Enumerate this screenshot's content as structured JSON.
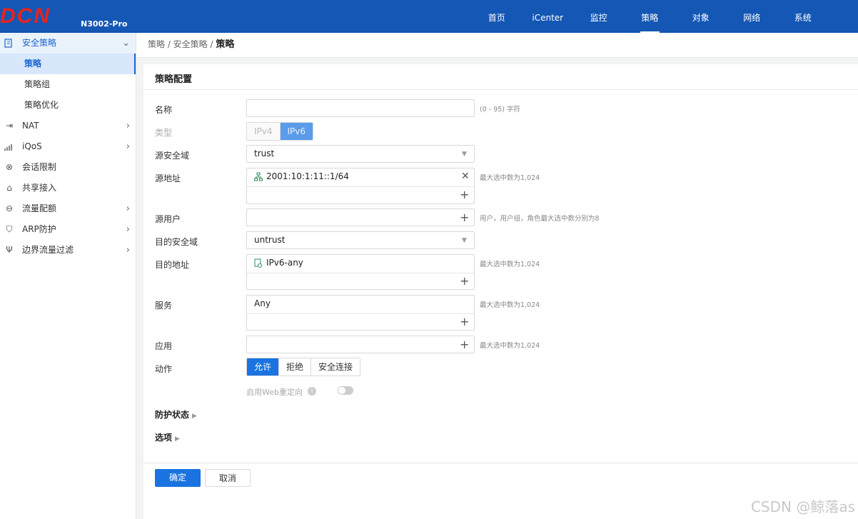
{
  "header": {
    "logo_text": "DCN",
    "model": "N3002-Pro",
    "nav": [
      "首页",
      "iCenter",
      "监控",
      "策略",
      "对象",
      "网络",
      "系统"
    ],
    "active_nav": "策略"
  },
  "sidebar": {
    "items": [
      {
        "label": "安全策略",
        "icon": "shield-doc-icon",
        "expanded": true,
        "children": [
          "策略",
          "策略组",
          "策略优化"
        ],
        "active_child": "策略"
      },
      {
        "label": "NAT",
        "icon": "nat-icon",
        "expandable": true
      },
      {
        "label": "iQoS",
        "icon": "qos-bars-icon",
        "expandable": true
      },
      {
        "label": "会话限制",
        "icon": "session-limit-icon"
      },
      {
        "label": "共享接入",
        "icon": "shared-access-icon"
      },
      {
        "label": "流量配额",
        "icon": "quota-icon",
        "expandable": true
      },
      {
        "label": "ARP防护",
        "icon": "arp-shield-icon",
        "expandable": true
      },
      {
        "label": "边界流量过滤",
        "icon": "filter-icon",
        "expandable": true
      }
    ]
  },
  "breadcrumb": {
    "path": "策略 / 安全策略 / ",
    "current": "策略"
  },
  "form": {
    "title": "策略配置",
    "name": {
      "label": "名称",
      "value": "",
      "hint": "(0 - 95) 字符"
    },
    "type": {
      "label": "类型",
      "options": [
        "IPv4",
        "IPv6"
      ],
      "selected": "IPv6"
    },
    "src_zone": {
      "label": "源安全域",
      "value": "trust"
    },
    "src_addr": {
      "label": "源地址",
      "value": "2001:10:1:11::1/64",
      "hint": "最大选中数为1,024"
    },
    "src_user": {
      "label": "源用户",
      "hint": "用户，用户组，角色最大选中数分别为8"
    },
    "dst_zone": {
      "label": "目的安全域",
      "value": "untrust"
    },
    "dst_addr": {
      "label": "目的地址",
      "value": "IPv6-any",
      "hint": "最大选中数为1,024"
    },
    "service": {
      "label": "服务",
      "value": "Any",
      "hint": "最大选中数为1,024"
    },
    "app": {
      "label": "应用",
      "hint": "最大选中数为1,024"
    },
    "action": {
      "label": "动作",
      "options": [
        "允许",
        "拒绝",
        "安全连接"
      ],
      "selected": "允许"
    },
    "web_redirect": {
      "label": "启用Web重定向",
      "enabled": false
    },
    "protection_label": "防护状态",
    "options_label": "选项"
  },
  "buttons": {
    "ok": "确定",
    "cancel": "取消"
  },
  "watermark": "CSDN @鲸落as",
  "colors": {
    "header": "#1457b4",
    "accent": "#1a73e0",
    "logo": "#e8231f"
  }
}
